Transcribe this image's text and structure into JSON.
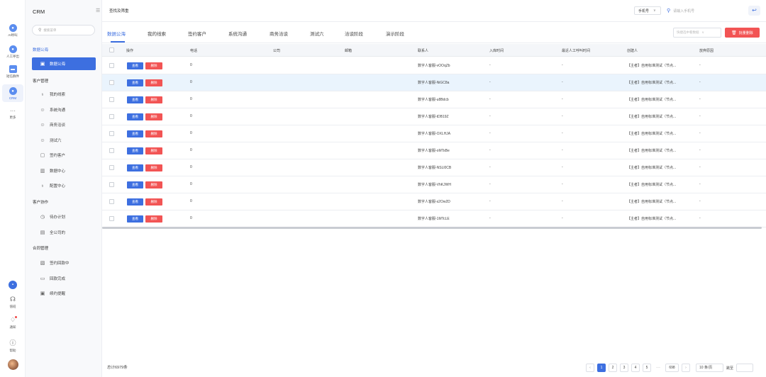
{
  "rail": {
    "items": [
      {
        "label": "AI呼叫"
      },
      {
        "label": "人工呼出"
      },
      {
        "label": "短信群件"
      },
      {
        "label": "CRM"
      },
      {
        "label": "更多"
      }
    ],
    "bottom": [
      {
        "label": "值班"
      },
      {
        "label": "通知"
      },
      {
        "label": "帮助"
      }
    ]
  },
  "sidebar": {
    "title": "CRM",
    "search_placeholder": "搜索菜单",
    "groups": [
      {
        "label": "数据公海",
        "items": [
          {
            "label": "数据公海"
          }
        ]
      },
      {
        "label": "客户管理",
        "items": [
          {
            "label": "我的线索"
          },
          {
            "label": "系统沟通"
          },
          {
            "label": "商务洽谈"
          },
          {
            "label": "测试六"
          },
          {
            "label": "签约客户"
          },
          {
            "label": "数据中心"
          },
          {
            "label": "配置中心"
          }
        ]
      },
      {
        "label": "客户协作",
        "items": [
          {
            "label": "待办计划"
          },
          {
            "label": "全公司的"
          }
        ]
      },
      {
        "label": "合同管理",
        "items": [
          {
            "label": "签约回款中"
          },
          {
            "label": "回款完成"
          },
          {
            "label": "续约提醒"
          }
        ]
      }
    ]
  },
  "topbar": {
    "breadcrumb": "查找及筛重",
    "phone_select": "手机号",
    "search_placeholder": "请输入手机号"
  },
  "tabs": [
    "数据公海",
    "我的线索",
    "签约客户",
    "系统沟通",
    "商务洽谈",
    "测试六",
    "洽谈阶段",
    "演示阶段"
  ],
  "toolbar": {
    "filter_placeholder": "快捷选中看数据",
    "bulk_delete": "批量删除"
  },
  "table": {
    "headers": [
      "操作",
      "电话",
      "公司",
      "邮箱",
      "联系人",
      "入库时间",
      "最近人工呼叫时间",
      "创建人",
      "放弃原因"
    ],
    "view_label": "查看",
    "delete_label": "删除",
    "rows": [
      {
        "phone": "0",
        "company": "",
        "email": "",
        "contact": "数字人客服-vOOqZb",
        "in_time": "-",
        "last_call": "-",
        "creator": "【主者】自用标准测试（节点...",
        "reason": "-"
      },
      {
        "phone": "0",
        "company": "",
        "email": "",
        "contact": "数字人客服-NiGC8a",
        "in_time": "-",
        "last_call": "-",
        "creator": "【主者】自用标准测试（节点...",
        "reason": "-"
      },
      {
        "phone": "0",
        "company": "",
        "email": "",
        "contact": "数字人客服-u8Bdcb",
        "in_time": "-",
        "last_call": "-",
        "creator": "【主者】自用标准测试（节点...",
        "reason": "-"
      },
      {
        "phone": "0",
        "company": "",
        "email": "",
        "contact": "数字人客服-tDB19Z",
        "in_time": "-",
        "last_call": "-",
        "creator": "【主者】自用标准测试（节点...",
        "reason": "-"
      },
      {
        "phone": "0",
        "company": "",
        "email": "",
        "contact": "数字人客服-OXLHJA",
        "in_time": "-",
        "last_call": "-",
        "creator": "【主者】自用标准测试（节点...",
        "reason": "-"
      },
      {
        "phone": "0",
        "company": "",
        "email": "",
        "contact": "数字人客服-oMTsBe",
        "in_time": "-",
        "last_call": "-",
        "creator": "【主者】自用标准测试（节点...",
        "reason": "-"
      },
      {
        "phone": "0",
        "company": "",
        "email": "",
        "contact": "数字人客服-NSLl0CB",
        "in_time": "-",
        "last_call": "-",
        "creator": "【主者】自用标准测试（节点...",
        "reason": "-"
      },
      {
        "phone": "0",
        "company": "",
        "email": "",
        "contact": "数字人客服-VhKJWH",
        "in_time": "-",
        "last_call": "-",
        "creator": "【主者】自用标准测试（节点...",
        "reason": "-"
      },
      {
        "phone": "0",
        "company": "",
        "email": "",
        "contact": "数字人客服-s2Ow2D",
        "in_time": "-",
        "last_call": "-",
        "creator": "【主者】自用标准测试（节点...",
        "reason": "-"
      },
      {
        "phone": "0",
        "company": "",
        "email": "",
        "contact": "数字人客服-1MTcLE",
        "in_time": "-",
        "last_call": "-",
        "creator": "【主者】自用标准测试（节点...",
        "reason": "-"
      }
    ]
  },
  "footer": {
    "total": "总计6979条",
    "pages": [
      "1",
      "2",
      "3",
      "4",
      "5"
    ],
    "ellipsis": "···",
    "last_page": "698",
    "page_size": "10 条/页",
    "jump_label": "跳至",
    "prev": "‹",
    "next": "›"
  },
  "colors": {
    "accent": "#3d6fe0",
    "danger": "#f25454",
    "row_highlight": "#eaf4fd"
  }
}
